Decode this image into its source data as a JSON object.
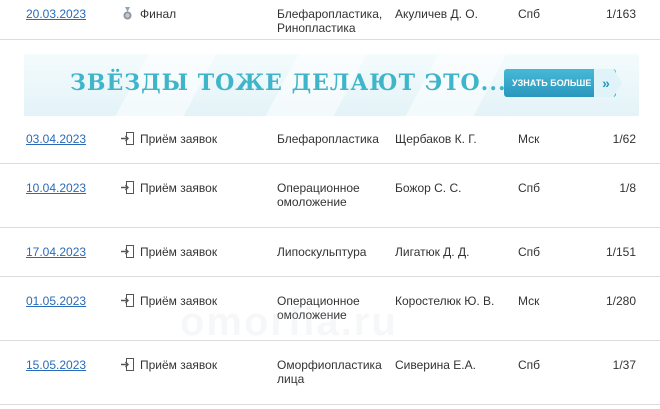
{
  "rows": [
    {
      "date": "20.03.2023",
      "stage": "Финал",
      "stage_icon": "medal-icon",
      "topic": [
        "Блефаропластика,",
        "Ринопластика"
      ],
      "author": "Акуличев Д. О.",
      "city": "Спб",
      "count": "1/163"
    },
    {
      "date": "03.04.2023",
      "stage": "Приём заявок",
      "stage_icon": "enter-icon",
      "topic": [
        "Блефаропластика"
      ],
      "author": "Щербаков К. Г.",
      "city": "Мск",
      "count": "1/62"
    },
    {
      "date": "10.04.2023",
      "stage": "Приём заявок",
      "stage_icon": "enter-icon",
      "topic": [
        "Операционное",
        "омоложение"
      ],
      "author": "Божор С. С.",
      "city": "Спб",
      "count": "1/8"
    },
    {
      "date": "17.04.2023",
      "stage": "Приём заявок",
      "stage_icon": "enter-icon",
      "topic": [
        "Липоскульптура"
      ],
      "author": "Лигатюк Д. Д.",
      "city": "Спб",
      "count": "1/151"
    },
    {
      "date": "01.05.2023",
      "stage": "Приём заявок",
      "stage_icon": "enter-icon",
      "topic": [
        "Операционное",
        "омоложение"
      ],
      "author": "Коростелюк Ю. В.",
      "city": "Мск",
      "count": "1/280"
    },
    {
      "date": "15.05.2023",
      "stage": "Приём заявок",
      "stage_icon": "enter-icon",
      "topic": [
        "Оморфиопластика",
        "лица"
      ],
      "author": "Сиверина Е.А.",
      "city": "Спб",
      "count": "1/37"
    }
  ],
  "banner": {
    "title": "ЗВЁЗДЫ ТОЖЕ ДЕЛАЮТ ЭТО...",
    "button_label": "УЗНАТЬ БОЛЬШЕ",
    "button_arrow": "»"
  },
  "watermark": "omorfia.ru",
  "colors": {
    "link": "#2a6bb8",
    "accent": "#3fb5c9",
    "divider": "#dcdcdc"
  }
}
